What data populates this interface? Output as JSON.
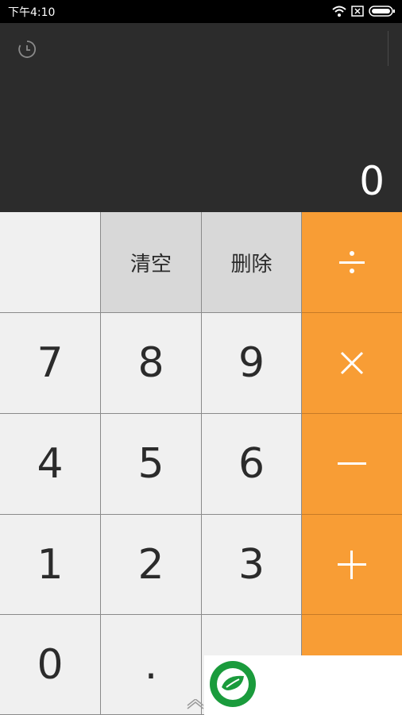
{
  "status_bar": {
    "time": "下午4:10",
    "icons": [
      "wifi-icon",
      "sim-off-icon",
      "battery-icon"
    ]
  },
  "display": {
    "value": "0",
    "icons": [
      "history-icon"
    ]
  },
  "keypad": {
    "clear_label": "清空",
    "delete_label": "删除",
    "divide": "÷",
    "multiply": "×",
    "subtract": "−",
    "add": "+",
    "digits": {
      "seven": "7",
      "eight": "8",
      "nine": "9",
      "four": "4",
      "five": "5",
      "six": "6",
      "one": "1",
      "two": "2",
      "three": "3",
      "zero": "0",
      "dot": "."
    }
  },
  "overlay": {
    "icon": "leaf-logo-icon"
  },
  "colors": {
    "operator": "#f89d35",
    "display_bg": "#2c2c2c",
    "key_bg": "#f0f0f0",
    "func_bg": "#d8d8d8",
    "logo_green": "#1a9b3c"
  }
}
